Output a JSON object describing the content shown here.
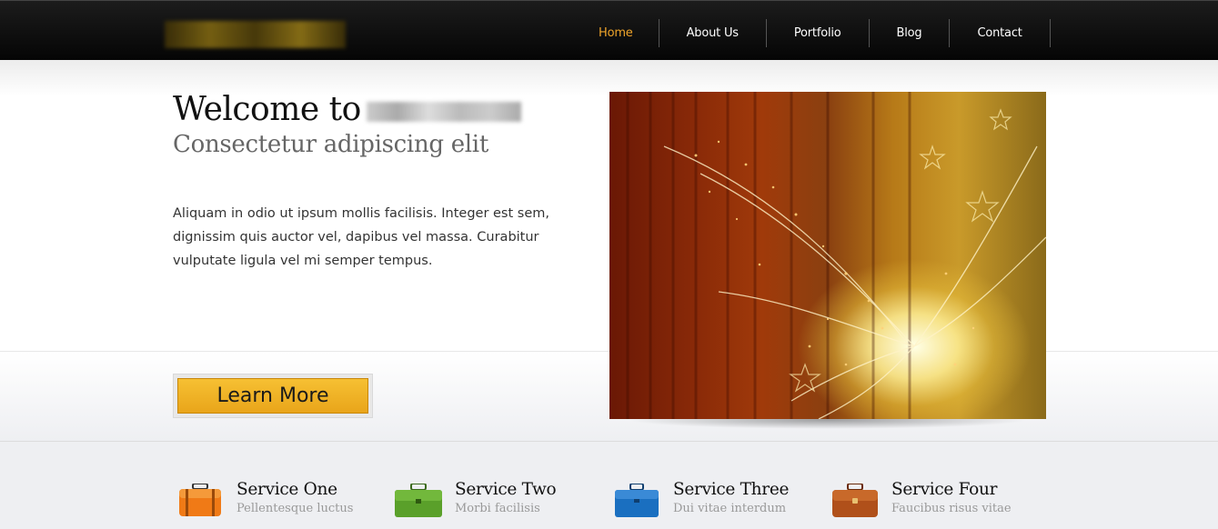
{
  "nav": {
    "items": [
      {
        "label": "Home",
        "active": true
      },
      {
        "label": "About Us",
        "active": false
      },
      {
        "label": "Portfolio",
        "active": false
      },
      {
        "label": "Blog",
        "active": false
      },
      {
        "label": "Contact",
        "active": false
      }
    ],
    "active_color": "#f0a52a"
  },
  "hero": {
    "heading": "Welcome to",
    "subheading": "Consectetur adipiscing elit",
    "body": "Aliquam in odio ut ipsum mollis facilisis. Integer est sem, dignissim quis auctor vel, dapibus vel massa. Curabitur vulputate ligula vel mi semper tempus.",
    "button_label": "Learn More",
    "button_color": "#f0b32a"
  },
  "services": [
    {
      "title": "Service One",
      "description": "Pellentesque luctus",
      "icon": "orange-suitcase-icon",
      "color": "#f07a16"
    },
    {
      "title": "Service Two",
      "description": "Morbi facilisis",
      "icon": "green-briefcase-icon",
      "color": "#5aa02a"
    },
    {
      "title": "Service Three",
      "description": "Dui vitae interdum",
      "icon": "blue-briefcase-icon",
      "color": "#1a6fc0"
    },
    {
      "title": "Service Four",
      "description": "Faucibus risus vitae",
      "icon": "brown-briefcase-icon",
      "color": "#b0501a"
    }
  ]
}
